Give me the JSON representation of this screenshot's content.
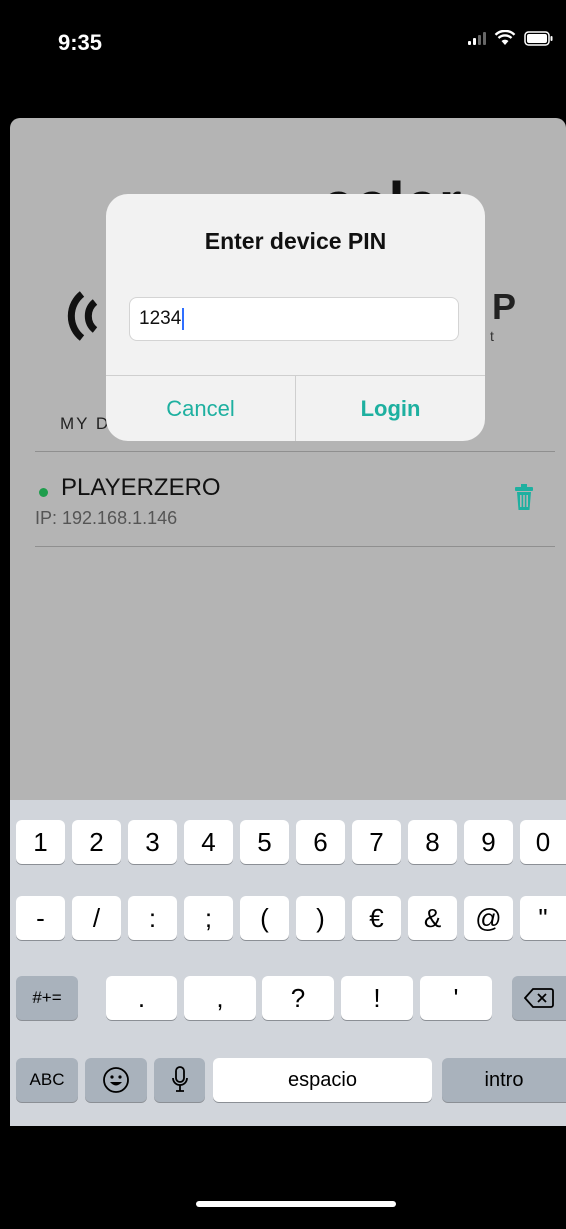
{
  "status_bar": {
    "time": "9:35"
  },
  "app": {
    "brand_text": "ecler",
    "side_text": "P",
    "side_subtext": "t",
    "section_title": "MY DEVICES",
    "devices": [
      {
        "name": "PLAYERZERO",
        "ip": "IP: 192.168.1.146",
        "online_color": "#1e9d4c"
      }
    ],
    "accent_color": "#1eb0a0"
  },
  "dialog": {
    "title": "Enter device PIN",
    "pin_value": "1234",
    "cancel_label": "Cancel",
    "login_label": "Login"
  },
  "keyboard": {
    "row1": [
      "1",
      "2",
      "3",
      "4",
      "5",
      "6",
      "7",
      "8",
      "9",
      "0"
    ],
    "row2": [
      "-",
      "/",
      ":",
      ";",
      "(",
      ")",
      "€",
      "&",
      "@",
      "\""
    ],
    "row3": [
      ".",
      ",",
      "?",
      "!",
      "'"
    ],
    "symbols_label": "#+=",
    "abc_label": "ABC",
    "space_label": "espacio",
    "return_label": "intro"
  }
}
